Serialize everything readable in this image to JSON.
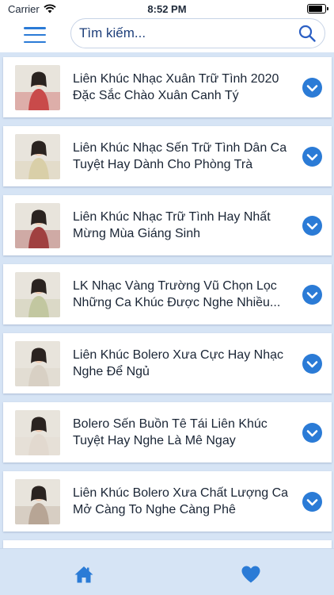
{
  "status_bar": {
    "carrier": "Carrier",
    "time": "8:52 PM",
    "battery_level": 0.85
  },
  "header": {
    "menu_icon": "hamburger-menu-icon",
    "search_placeholder": "Tìm kiếm...",
    "search_icon": "search-icon"
  },
  "colors": {
    "accent": "#2b7bd6",
    "background": "#d6e4f5",
    "card": "#ffffff"
  },
  "playlists": [
    {
      "title": "Liên Khúc Nhạc Xuân Trữ Tình 2020 Đặc Sắc Chào Xuân Canh Tý",
      "thumb_tint": "#c94a4a"
    },
    {
      "title": "Liên Khúc Nhạc Sến Trữ Tình Dân Ca Tuyệt Hay Dành Cho Phòng Trà",
      "thumb_tint": "#d9cfa8"
    },
    {
      "title": "Liên Khúc Nhạc Trữ Tình Hay Nhất Mừng Mùa Giáng Sinh",
      "thumb_tint": "#a04040"
    },
    {
      "title": "LK Nhạc Vàng Trường Vũ Chọn Lọc Những Ca Khúc Được Nghe Nhiều...",
      "thumb_tint": "#c2c7a0"
    },
    {
      "title": "Liên Khúc Bolero Xưa Cực Hay Nhạc Nghe Để Ngủ",
      "thumb_tint": "#d8d0c4"
    },
    {
      "title": "Bolero Sến Buồn Tê Tái Liên Khúc Tuyệt Hay Nghe Là Mê Ngay",
      "thumb_tint": "#e2d9cf"
    },
    {
      "title": "Liên Khúc Bolero Xưa Chất Lượng Ca Mở Càng To Nghe Càng Phê",
      "thumb_tint": "#b7a595"
    },
    {
      "title": "",
      "thumb_tint": "#c9b7a5"
    }
  ],
  "tabs": [
    {
      "name": "home",
      "icon": "home-icon",
      "active": true
    },
    {
      "name": "favorites",
      "icon": "heart-icon",
      "active": false
    }
  ]
}
